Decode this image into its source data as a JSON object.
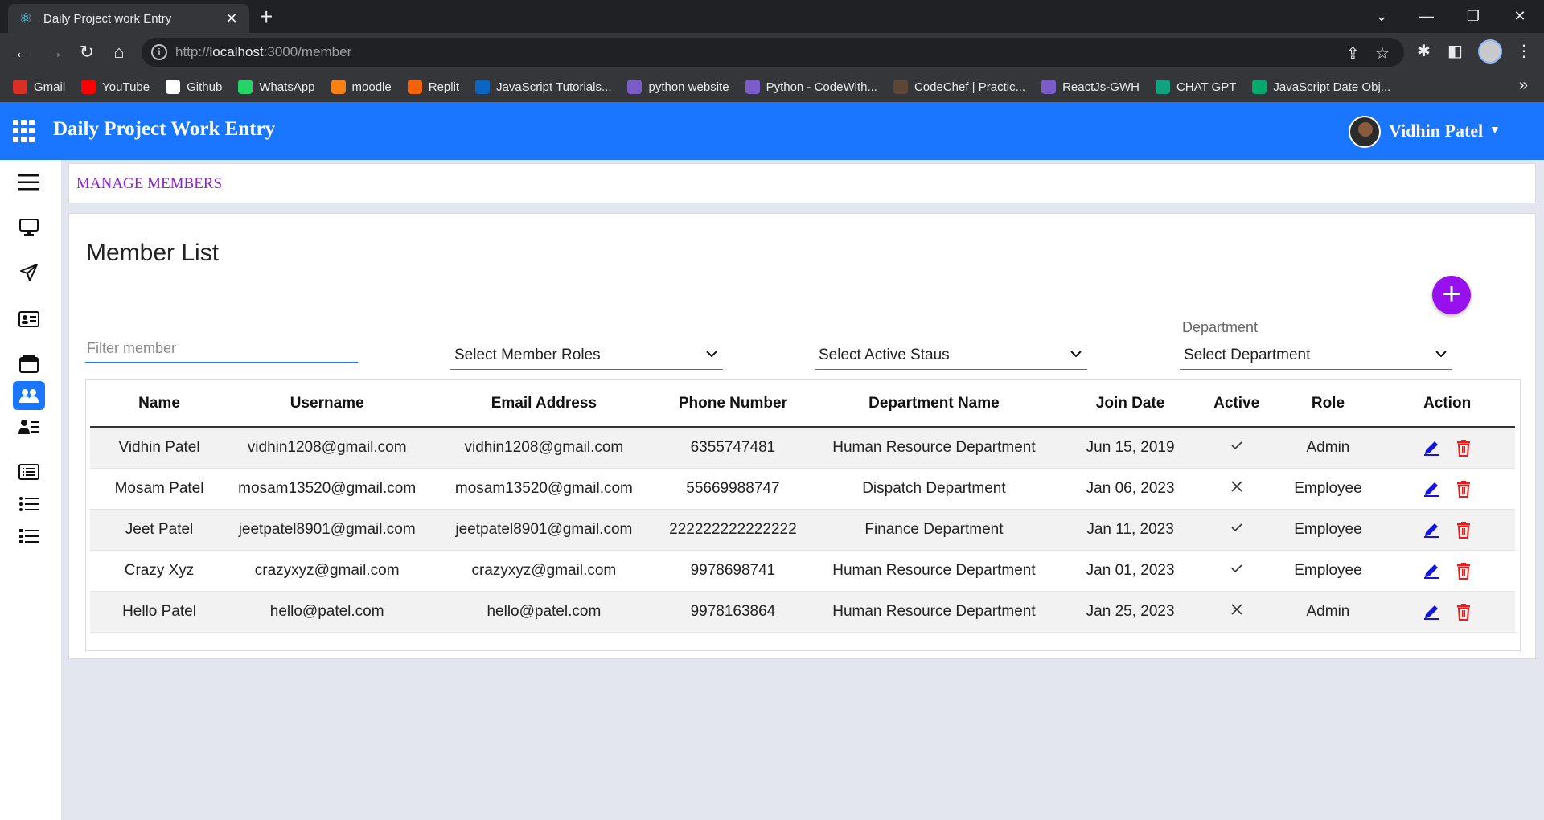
{
  "browser": {
    "tab_title": "Daily Project work Entry",
    "url_scheme": "http://",
    "url_host": "localhost",
    "url_path": ":3000/member",
    "bookmarks": [
      {
        "label": "Gmail",
        "icon": "gmail-icon",
        "color": "#d93025"
      },
      {
        "label": "YouTube",
        "icon": "youtube-icon",
        "color": "#ff0000"
      },
      {
        "label": "Github",
        "icon": "github-icon",
        "color": "#ffffff"
      },
      {
        "label": "WhatsApp",
        "icon": "whatsapp-icon",
        "color": "#25d366"
      },
      {
        "label": "moodle",
        "icon": "moodle-icon",
        "color": "#f98012"
      },
      {
        "label": "Replit",
        "icon": "replit-icon",
        "color": "#f26207"
      },
      {
        "label": "JavaScript Tutorials...",
        "icon": "linkedin-icon",
        "color": "#0a66c2"
      },
      {
        "label": "python website",
        "icon": "python-icon",
        "color": "#7b5dc9"
      },
      {
        "label": "Python - CodeWith...",
        "icon": "codewithharry-icon",
        "color": "#7b5dc9"
      },
      {
        "label": "CodeChef | Practic...",
        "icon": "codechef-icon",
        "color": "#5b4638"
      },
      {
        "label": "ReactJs-GWH",
        "icon": "gwh-icon",
        "color": "#7b5dc9"
      },
      {
        "label": "CHAT GPT",
        "icon": "chatgpt-icon",
        "color": "#10a37f"
      },
      {
        "label": "JavaScript Date Obj...",
        "icon": "w3schools-icon",
        "color": "#04aa6d"
      }
    ]
  },
  "header": {
    "title": "Daily Project Work Entry",
    "user_name": "Vidhin Patel"
  },
  "breadcrumb": "MANAGE MEMBERS",
  "main": {
    "title": "Member List",
    "filter_placeholder": "Filter member",
    "roles_select": "Select Member Roles",
    "status_select": "Select Active Staus",
    "department_label": "Department",
    "department_select": "Select Department",
    "accent_color": "#1a75ff",
    "add_button_color": "#9810ec"
  },
  "table": {
    "headers": [
      "Name",
      "Username",
      "Email Address",
      "Phone Number",
      "Department Name",
      "Join Date",
      "Active",
      "Role",
      "Action"
    ],
    "rows": [
      {
        "name": "Vidhin Patel",
        "username": "vidhin1208@gmail.com",
        "email": "vidhin1208@gmail.com",
        "phone": "6355747481",
        "department": "Human Resource Department",
        "join_date": "Jun 15, 2019",
        "active": true,
        "role": "Admin"
      },
      {
        "name": "Mosam Patel",
        "username": "mosam13520@gmail.com",
        "email": "mosam13520@gmail.com",
        "phone": "55669988747",
        "department": "Dispatch Department",
        "join_date": "Jan 06, 2023",
        "active": false,
        "role": "Employee"
      },
      {
        "name": "Jeet Patel",
        "username": "jeetpatel8901@gmail.com",
        "email": "jeetpatel8901@gmail.com",
        "phone": "222222222222222",
        "department": "Finance Department",
        "join_date": "Jan 11, 2023",
        "active": true,
        "role": "Employee"
      },
      {
        "name": "Crazy Xyz",
        "username": "crazyxyz@gmail.com",
        "email": "crazyxyz@gmail.com",
        "phone": "9978698741",
        "department": "Human Resource Department",
        "join_date": "Jan 01, 2023",
        "active": true,
        "role": "Employee"
      },
      {
        "name": "Hello Patel",
        "username": "hello@patel.com",
        "email": "hello@patel.com",
        "phone": "9978163864",
        "department": "Human Resource Department",
        "join_date": "Jan 25, 2023",
        "active": false,
        "role": "Admin"
      }
    ]
  }
}
